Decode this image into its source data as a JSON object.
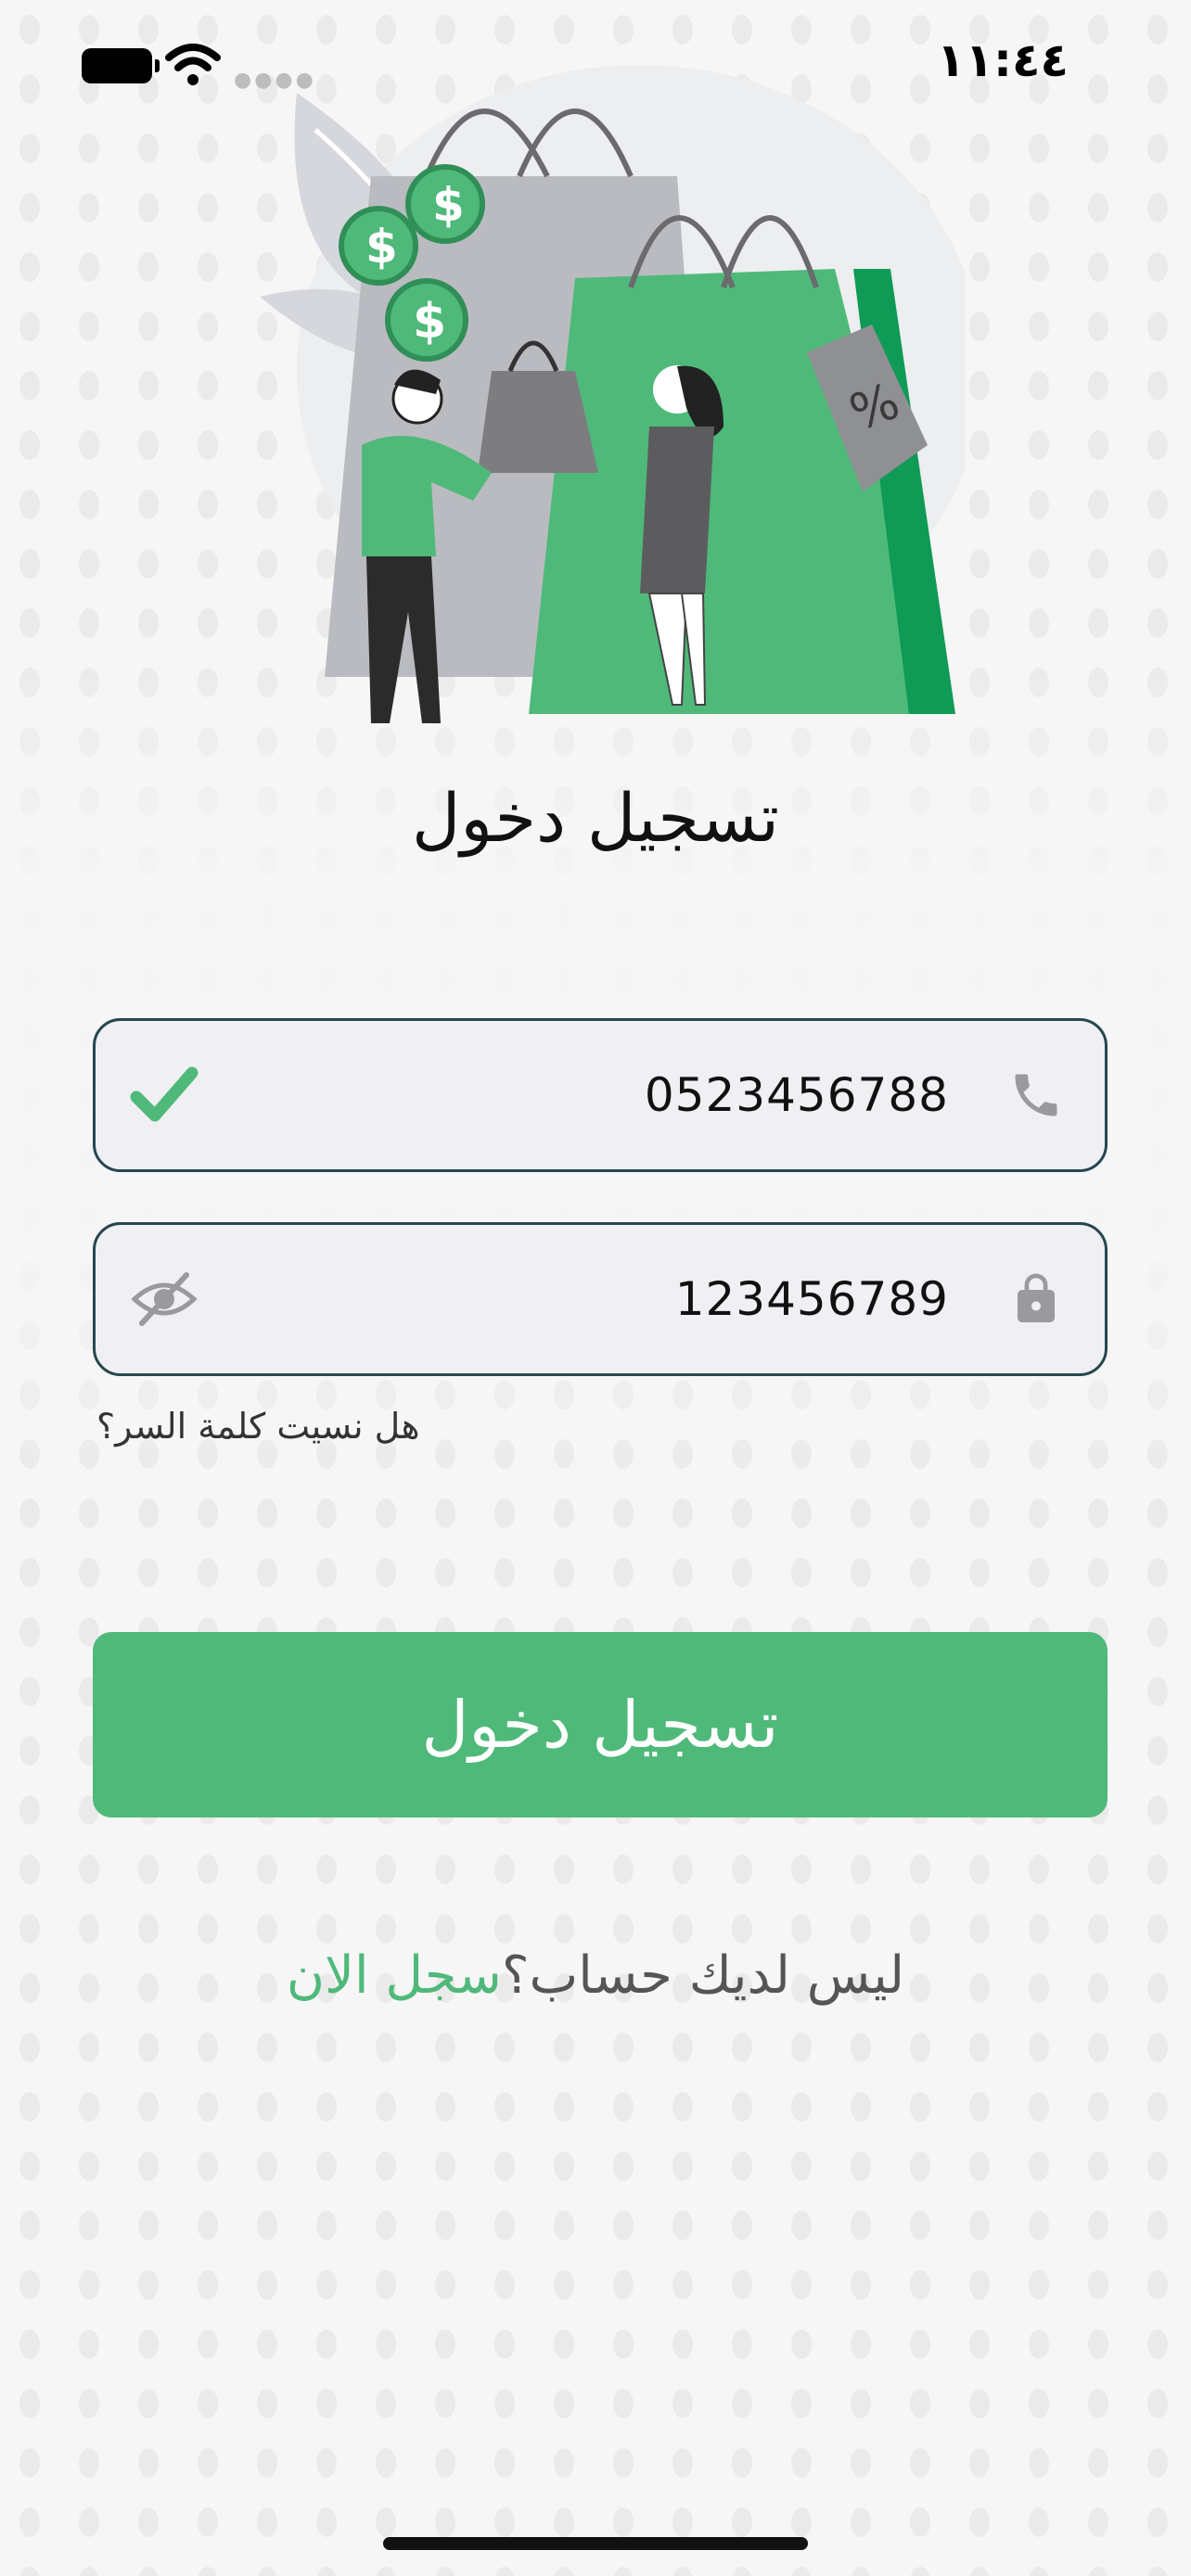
{
  "status_bar": {
    "time": "١١:٤٤",
    "battery_icon": "battery-icon",
    "wifi_icon": "wifi-icon",
    "signal_icon": "signal-icon"
  },
  "hero": {
    "illustration": "shopping-illustration"
  },
  "login": {
    "title": "تسجيل دخول",
    "phone_field": {
      "value": "0523456788",
      "icon": "phone-icon",
      "status_icon": "check-icon"
    },
    "password_field": {
      "value": "123456789",
      "icon": "lock-icon",
      "toggle_icon": "eye-off-icon"
    },
    "forgot_password": "هل نسيت كلمة السر؟",
    "submit_label": "تسجيل دخول",
    "signup_question": "ليس لديك حساب؟",
    "signup_link": "سجل الان"
  },
  "colors": {
    "accent": "#4fb97a",
    "field_border": "#26474f",
    "field_bg": "#f0f0f4",
    "background": "#f6f6f6"
  }
}
